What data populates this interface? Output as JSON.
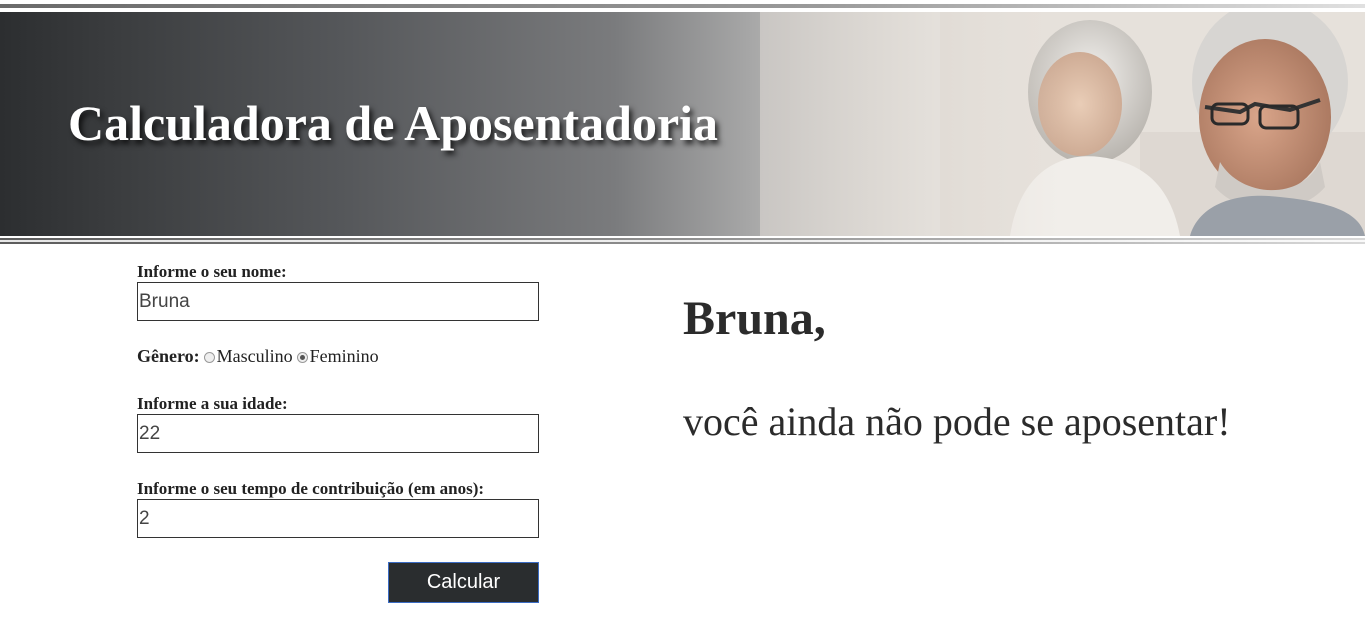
{
  "header": {
    "title": "Calculadora de Aposentadoria"
  },
  "form": {
    "name_label": "Informe o seu nome:",
    "name_value": "Bruna",
    "gender_label": "Gênero:",
    "gender_options": [
      "Masculino",
      "Feminino"
    ],
    "gender_selected": "Feminino",
    "age_label": "Informe a sua idade:",
    "age_value": "22",
    "contribution_label": "Informe o seu tempo de contribuição (em anos):",
    "contribution_value": "2",
    "submit_label": "Calcular"
  },
  "result": {
    "name_line": "Bruna,",
    "message": "você ainda não pode se aposentar!"
  },
  "colors": {
    "button_bg": "#2a2d2f",
    "button_border": "#3b6cc4",
    "title_color": "#ffffff"
  }
}
